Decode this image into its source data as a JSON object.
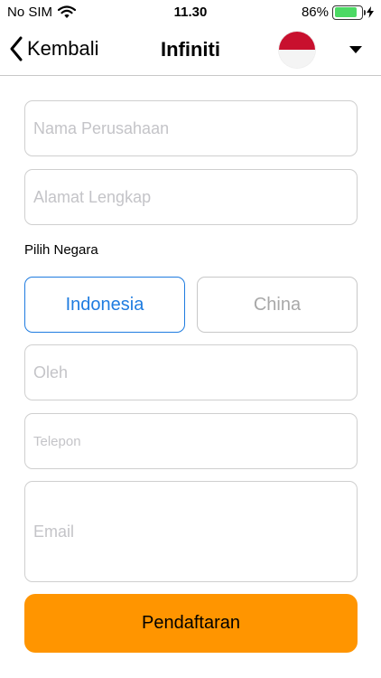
{
  "status_bar": {
    "carrier": "No SIM",
    "time": "11.30",
    "battery_percent": "86%",
    "battery_level": 0.86
  },
  "nav": {
    "back_label": "Kembali",
    "title": "Infiniti",
    "flag_colors": {
      "top": "#c8102e",
      "bottom": "#f4f4f4"
    }
  },
  "form": {
    "company_name_placeholder": "Nama Perusahaan",
    "address_placeholder": "Alamat Lengkap",
    "country_label": "Pilih Negara",
    "countries": [
      {
        "label": "Indonesia",
        "selected": true
      },
      {
        "label": "China",
        "selected": false
      }
    ],
    "by_placeholder": "Oleh",
    "phone_placeholder": "Telepon",
    "email_placeholder": "Email",
    "submit_label": "Pendaftaran"
  },
  "colors": {
    "accent": "#1f7ce0",
    "submit": "#ff9500",
    "battery": "#4cd964"
  },
  "icons": {
    "back": "chevron-left-icon",
    "wifi": "wifi-icon",
    "battery": "battery-icon",
    "charging": "bolt-icon",
    "dropdown": "caret-down-icon"
  }
}
